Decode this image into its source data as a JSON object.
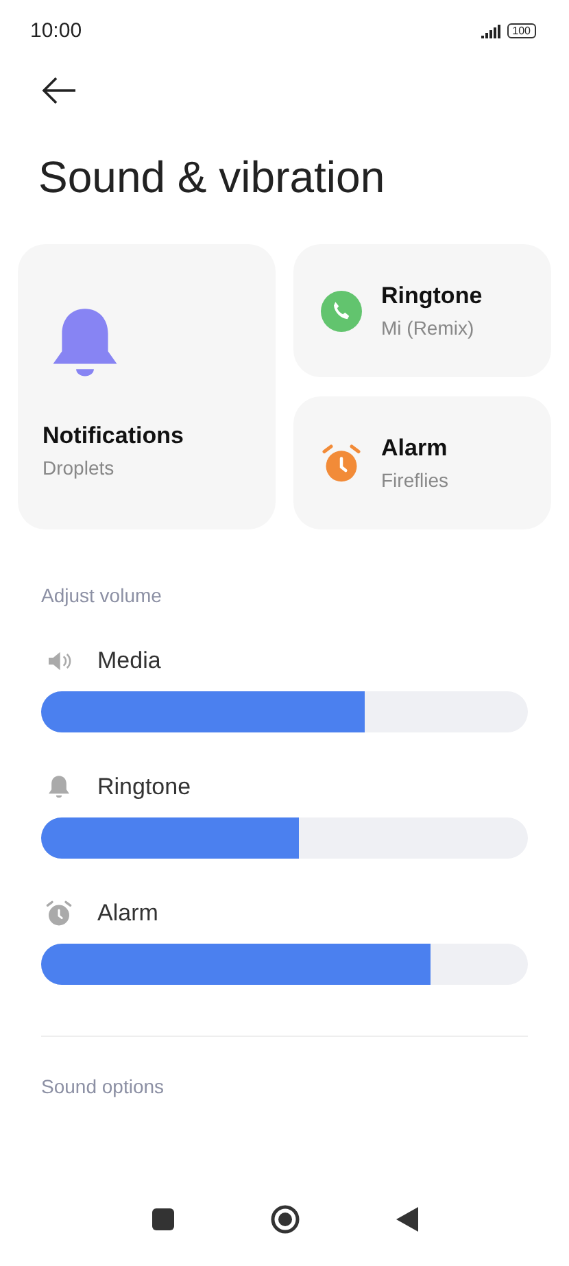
{
  "status_bar": {
    "time": "10:00",
    "battery": "100"
  },
  "title": "Sound & vibration",
  "cards": [
    {
      "kind": "bell",
      "title": "Notifications",
      "subtitle": "Droplets"
    },
    {
      "kind": "phone",
      "title": "Ringtone",
      "subtitle": "Mi (Remix)"
    },
    {
      "kind": "alarm",
      "title": "Alarm",
      "subtitle": "Fireflies"
    }
  ],
  "volume_section": {
    "heading": "Adjust volume",
    "sliders": [
      {
        "kind": "speaker",
        "label": "Media",
        "level": 0.665
      },
      {
        "kind": "bell",
        "label": "Ringtone",
        "level": 0.53
      },
      {
        "kind": "alarm",
        "label": "Alarm",
        "level": 0.8
      }
    ]
  },
  "options_section": {
    "heading": "Sound options"
  }
}
